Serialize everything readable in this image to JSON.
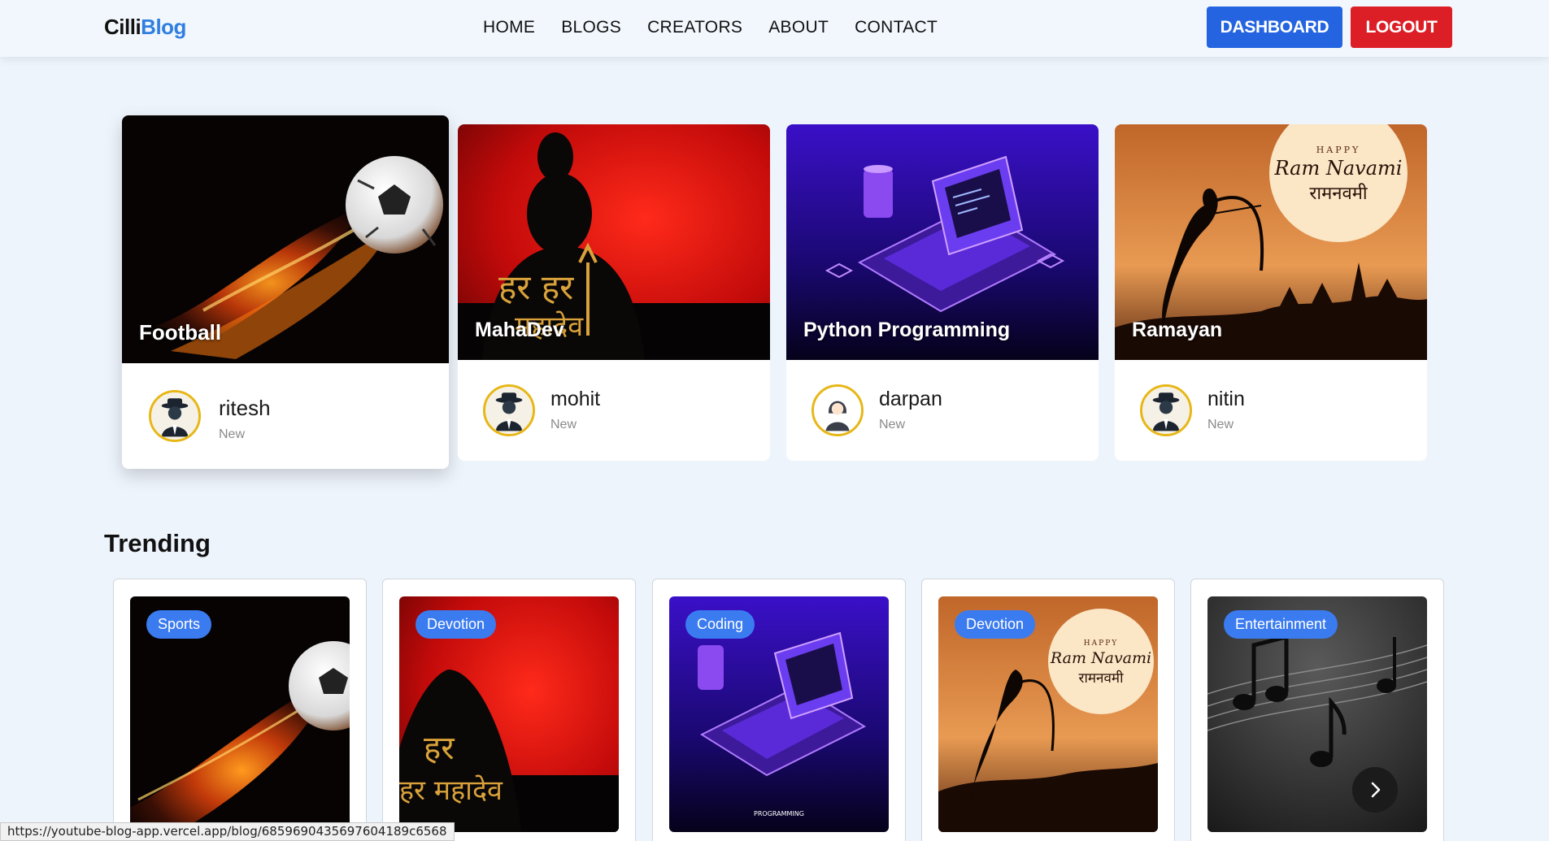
{
  "navbar": {
    "logo_part1": "Cilli",
    "logo_part2": "Blog",
    "links": [
      "HOME",
      "BLOGS",
      "CREATORS",
      "ABOUT",
      "CONTACT"
    ],
    "dashboard_label": "DASHBOARD",
    "logout_label": "LOGOUT"
  },
  "featured": [
    {
      "title": "Football",
      "author": "ritesh",
      "status": "New"
    },
    {
      "title": "MahaDev",
      "author": "mohit",
      "status": "New"
    },
    {
      "title": "Python Programming",
      "author": "darpan",
      "status": "New"
    },
    {
      "title": "Ramayan",
      "author": "nitin",
      "status": "New"
    }
  ],
  "trending": {
    "heading": "Trending",
    "cards": [
      {
        "tag": "Sports"
      },
      {
        "tag": "Devotion"
      },
      {
        "tag": "Coding"
      },
      {
        "tag": "Devotion"
      },
      {
        "tag": "Entertainment"
      }
    ]
  },
  "image_text": {
    "happy": "HAPPY",
    "ram_navami": "Ram Navami",
    "ram_navami_hindi": "रामनवमी",
    "har_har": "हर हर",
    "mahadev_hindi": "महादेव",
    "programming": "PROGRAMMING"
  },
  "status_url": "https://youtube-blog-app.vercel.app/blog/6859690435697604189c6568",
  "colors": {
    "primary": "#2464e0",
    "danger": "#dc1f26",
    "accent": "#2f7fe0",
    "tag": "#3b7bf0",
    "background": "#eef4fc"
  },
  "icons": [
    "chevron-right-icon",
    "spy-avatar-icon",
    "woman-avatar-icon"
  ]
}
